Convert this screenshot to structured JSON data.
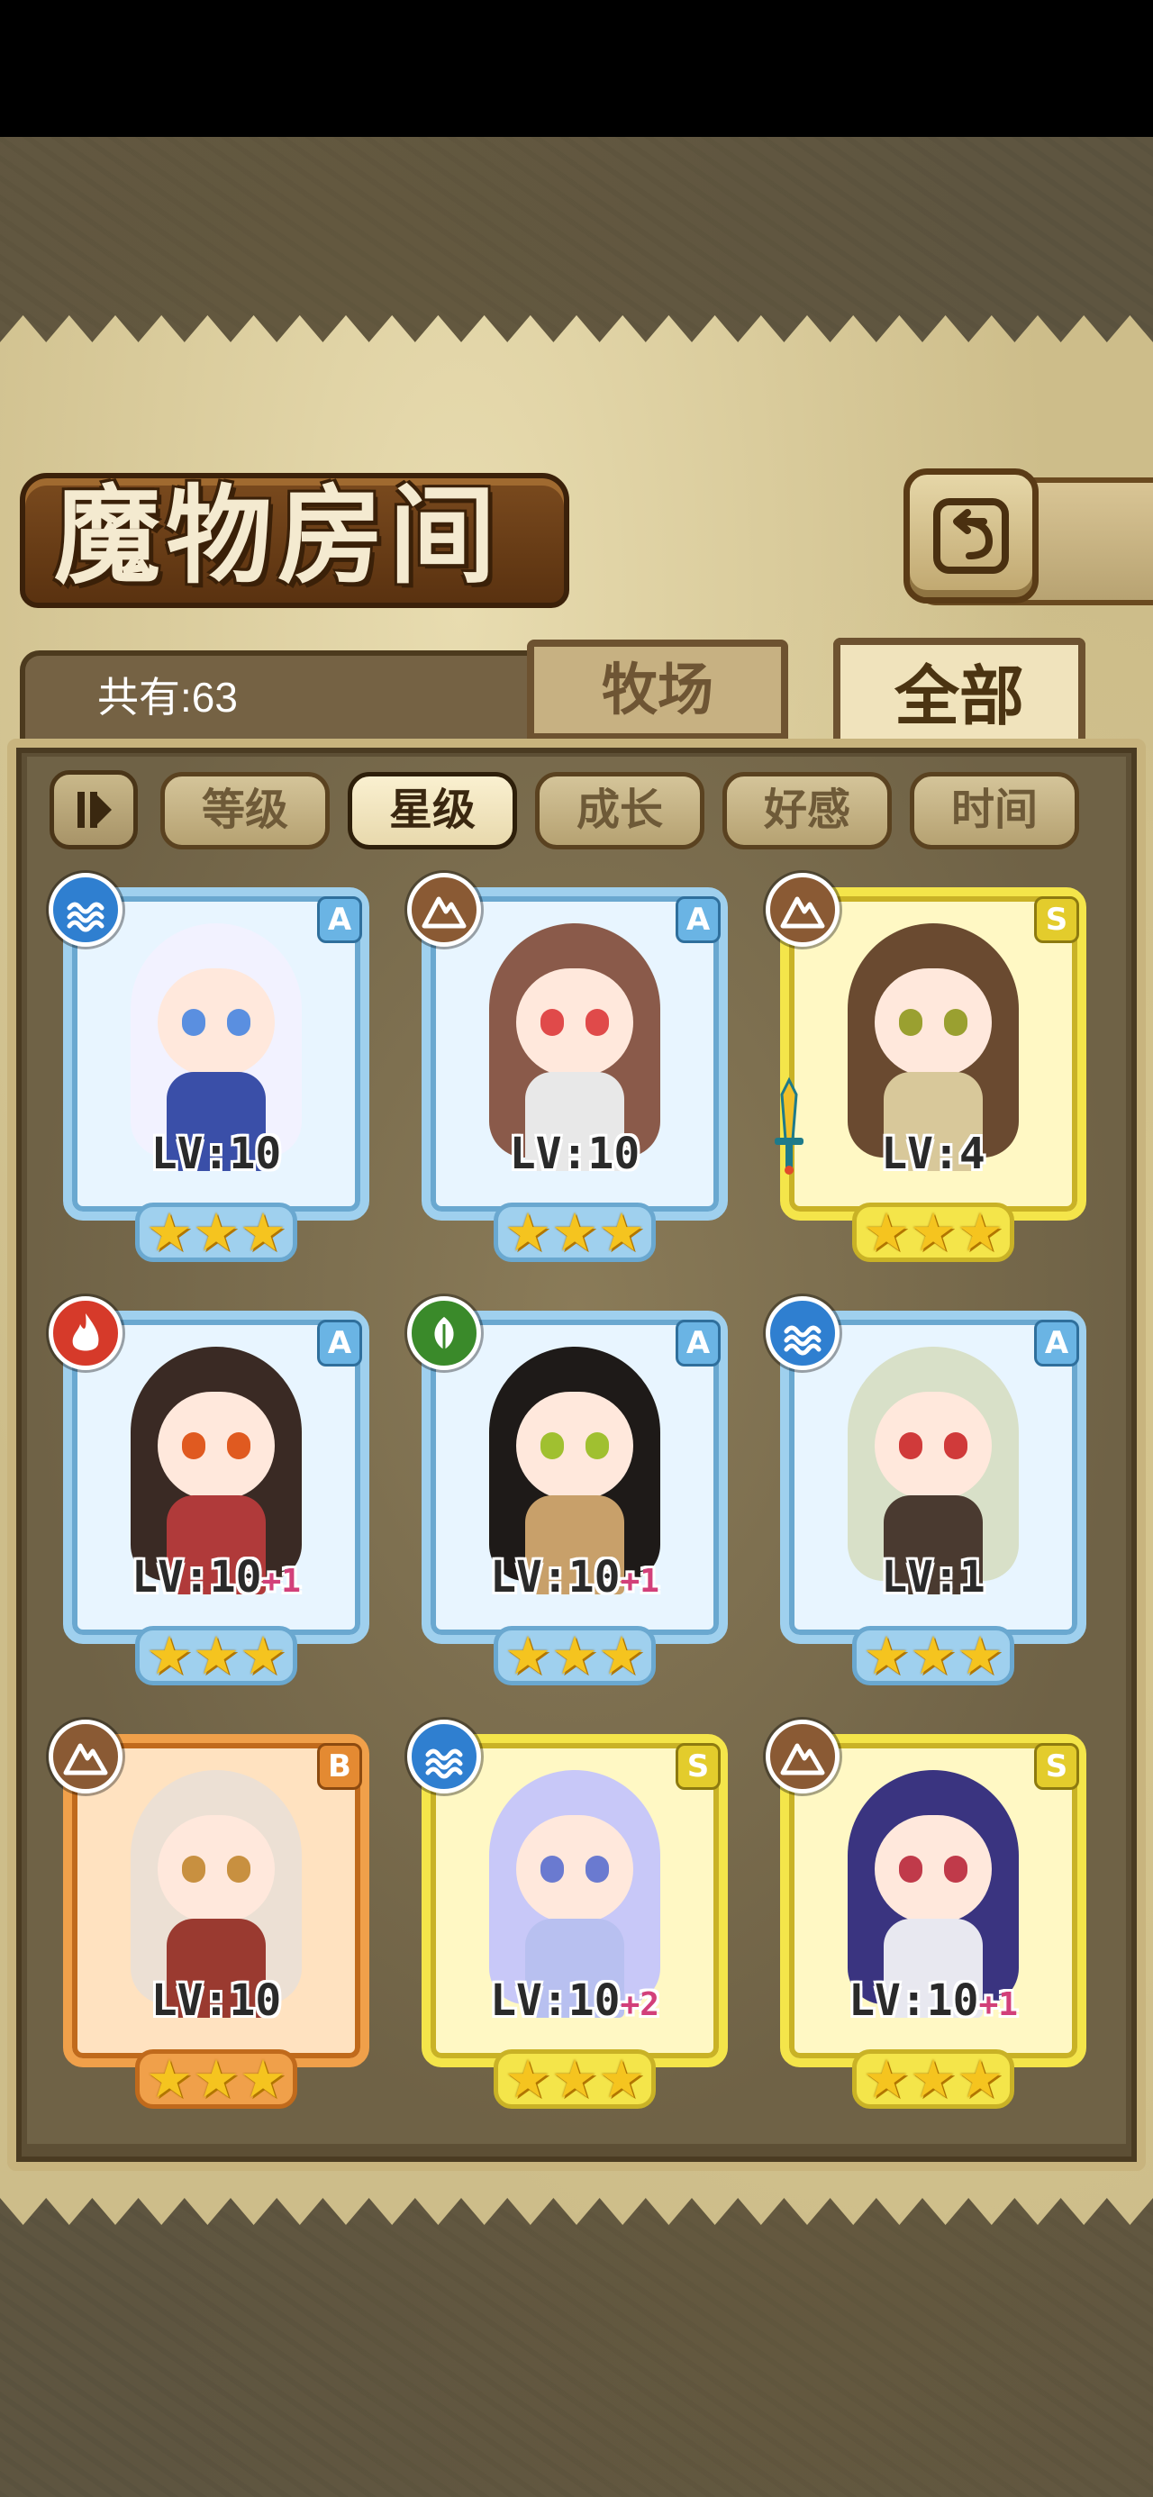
{
  "header": {
    "title": "魔物房间"
  },
  "tabs": {
    "ranch": "牧场",
    "all": "全部"
  },
  "count": {
    "text": "共有:63"
  },
  "sort": {
    "buttons": [
      "等级",
      "星级",
      "成长",
      "好感",
      "时间"
    ],
    "active": "星级"
  },
  "colors": {
    "water": "#2f7fd0",
    "earth": "#8a5a34",
    "fire": "#d63a2a",
    "grass": "#3a8a2a",
    "rank_A": "#9fd0ee",
    "rank_S": "#f4e54a",
    "rank_B": "#f0a04a"
  },
  "monsters": [
    {
      "rank": "A",
      "element": "water",
      "lv": "LV:10",
      "plus": "",
      "stars": 3,
      "hair": "#f2f2ff",
      "eye": "#5a8fe0",
      "body": "#3a4fa8"
    },
    {
      "rank": "A",
      "element": "earth",
      "lv": "LV:10",
      "plus": "",
      "stars": 3,
      "hair": "#8a5a4a",
      "eye": "#e04a4a",
      "body": "#e8e8e8"
    },
    {
      "rank": "S",
      "element": "earth",
      "lv": "LV:4",
      "plus": "",
      "stars": 3,
      "hair": "#6a4a30",
      "eye": "#9aa030",
      "body": "#d8c89a",
      "weapon": "sword-icon"
    },
    {
      "rank": "A",
      "element": "fire",
      "lv": "LV:10",
      "plus": "+1",
      "stars": 3,
      "hair": "#3a2a24",
      "eye": "#e05a20",
      "body": "#b03a3a"
    },
    {
      "rank": "A",
      "element": "grass",
      "lv": "LV:10",
      "plus": "+1",
      "stars": 3,
      "hair": "#1e1a18",
      "eye": "#a0c030",
      "body": "#c8a06a"
    },
    {
      "rank": "A",
      "element": "water",
      "lv": "LV:1",
      "plus": "",
      "stars": 3,
      "hair": "#d8e0c8",
      "eye": "#d03a3a",
      "body": "#4a3a30"
    },
    {
      "rank": "B",
      "element": "earth",
      "lv": "LV:10",
      "plus": "",
      "stars": 3,
      "hair": "#ece0d4",
      "eye": "#c89040",
      "body": "#9a3a30"
    },
    {
      "rank": "S",
      "element": "water",
      "lv": "LV:10",
      "plus": "+2",
      "stars": 3,
      "hair": "#c8c8f8",
      "eye": "#6a7ad0",
      "body": "#b8c0f0"
    },
    {
      "rank": "S",
      "element": "earth",
      "lv": "LV:10",
      "plus": "+1",
      "stars": 3,
      "hair": "#3a3480",
      "eye": "#c03a4a",
      "body": "#e8e8f0"
    }
  ]
}
